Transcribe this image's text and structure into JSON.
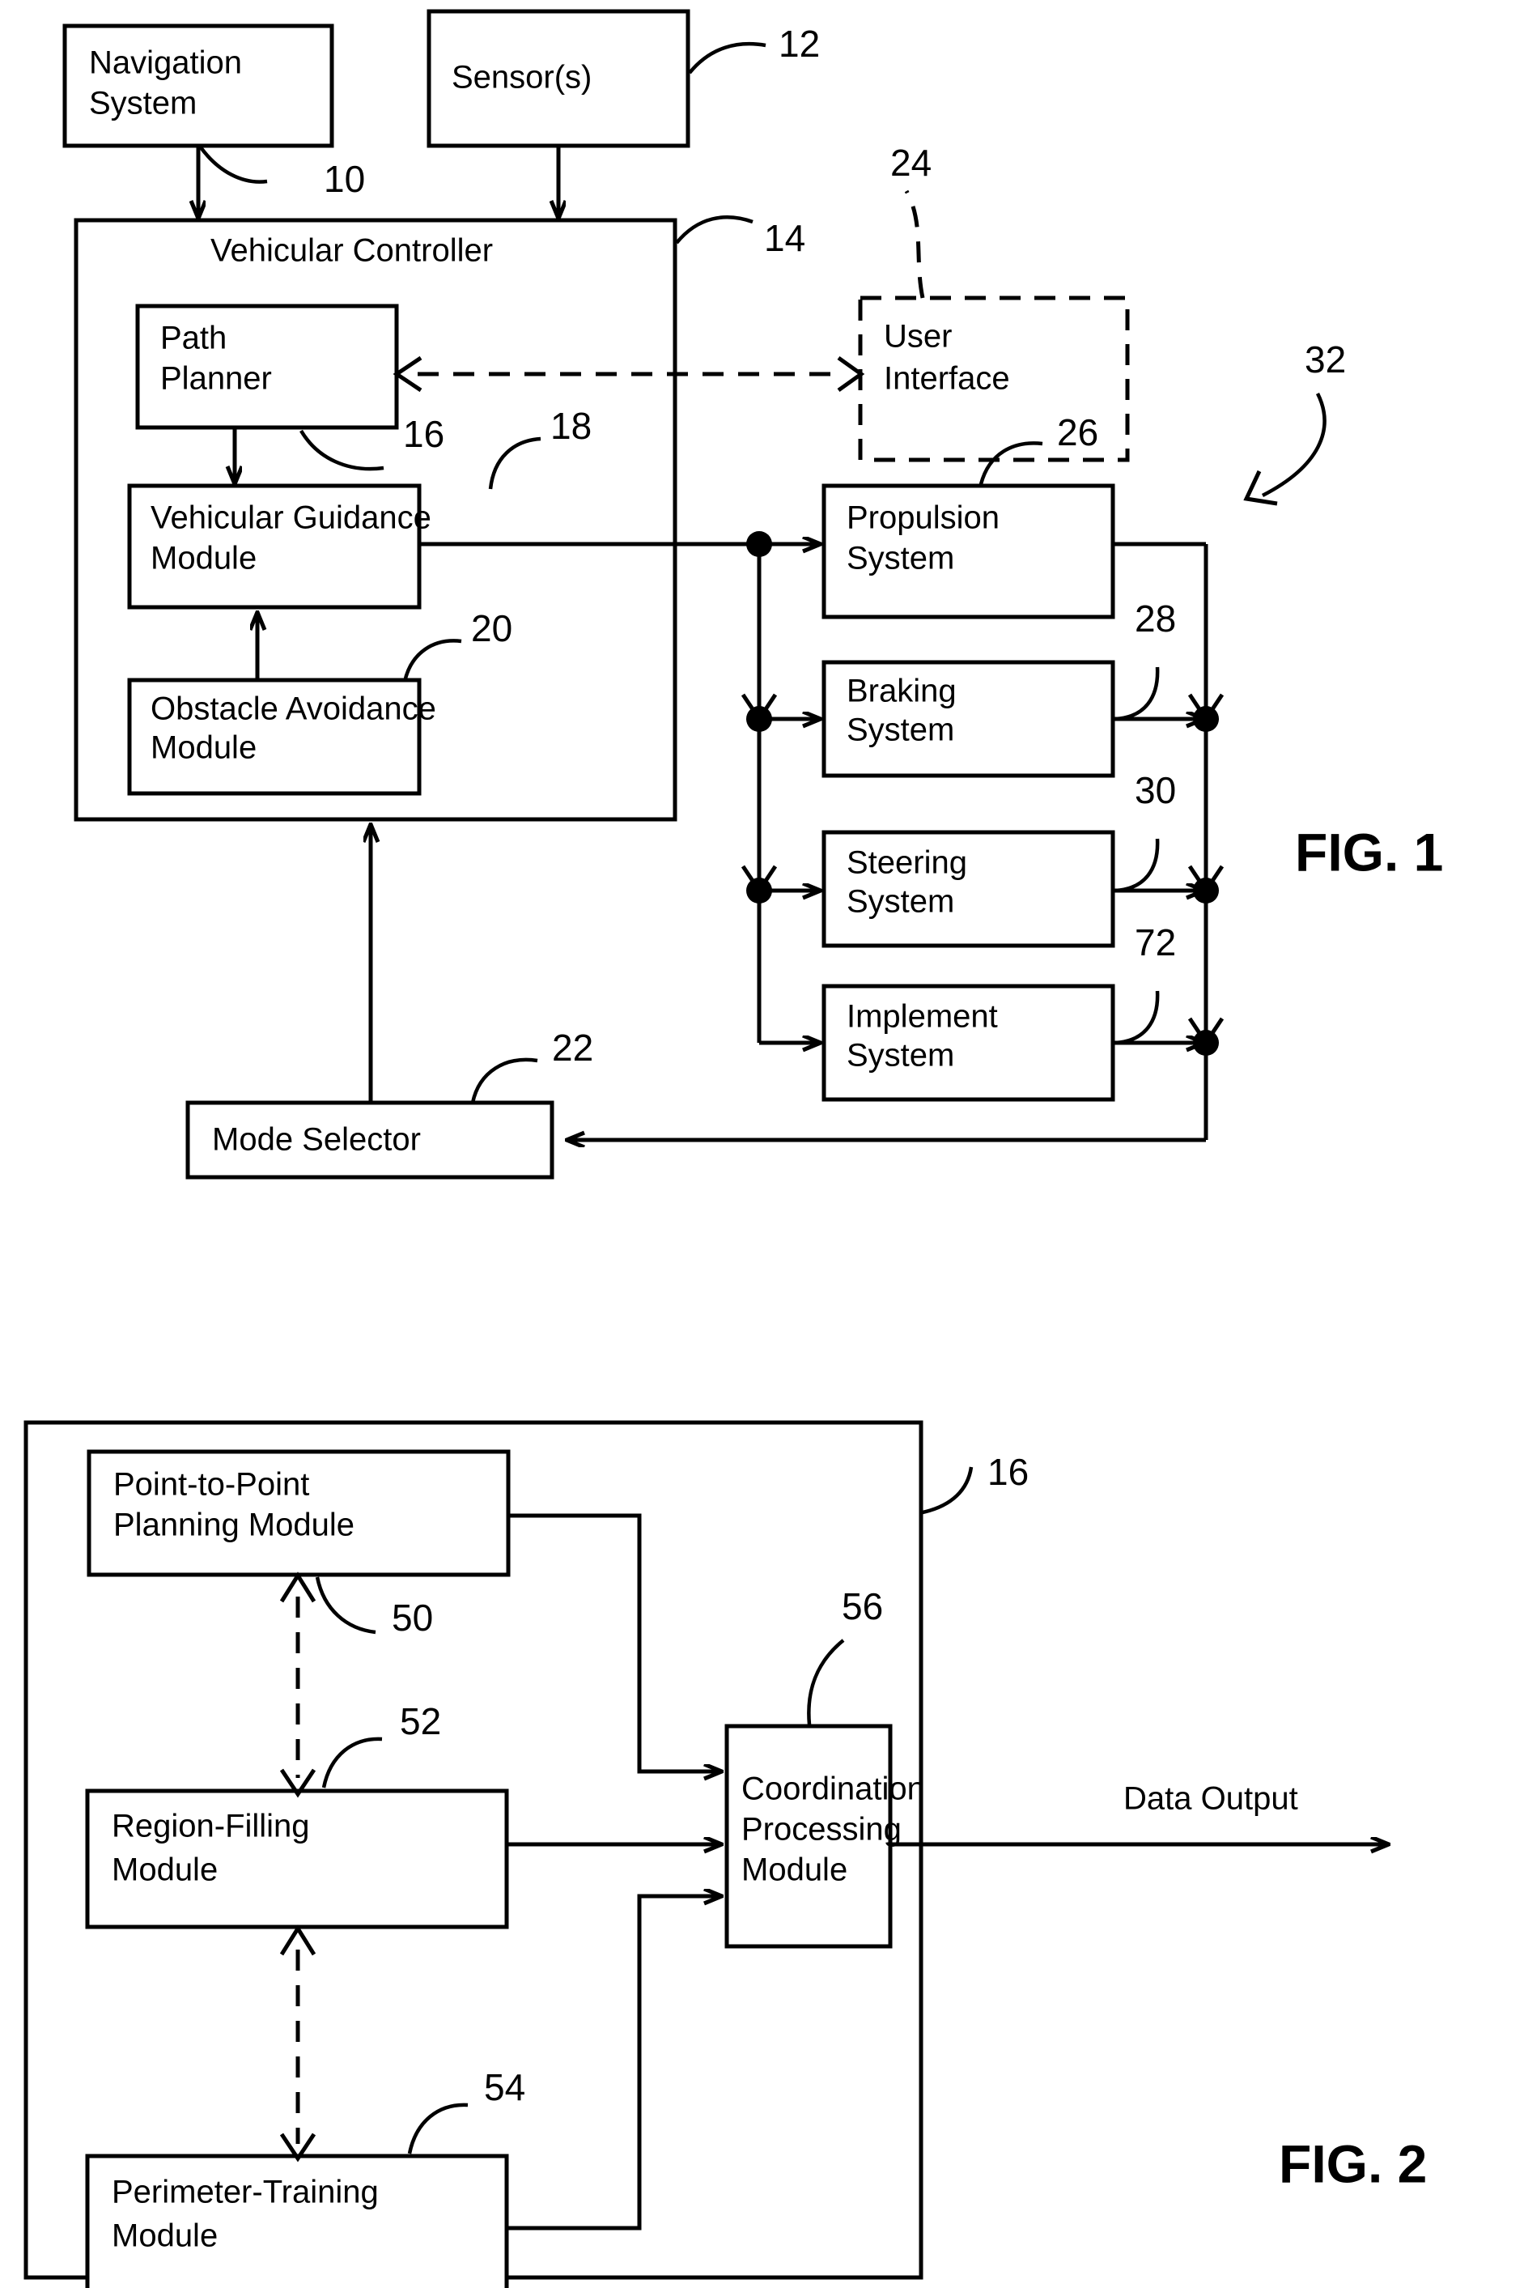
{
  "figures": [
    {
      "id": "fig1",
      "label": "FIG. 1",
      "boxes": {
        "navigation_system": "Navigation\nSystem",
        "navigation_system_l1": "Navigation",
        "navigation_system_l2": "System",
        "sensors": "Sensor(s)",
        "vehicular_controller": "Vehicular Controller",
        "path_planner_l1": "Path",
        "path_planner_l2": "Planner",
        "vehicular_guidance_l1": "Vehicular Guidance",
        "vehicular_guidance_l2": "Module",
        "obstacle_avoidance_l1": "Obstacle Avoidance",
        "obstacle_avoidance_l2": "Module",
        "mode_selector": "Mode Selector",
        "user_interface_l1": "User",
        "user_interface_l2": "Interface",
        "propulsion_l1": "Propulsion",
        "propulsion_l2": "System",
        "braking_l1": "Braking",
        "braking_l2": "System",
        "steering_l1": "Steering",
        "steering_l2": "System",
        "implement_l1": "Implement",
        "implement_l2": "System"
      },
      "reference_numerals": {
        "navigation_system": "10",
        "sensors": "12",
        "vehicular_controller": "14",
        "path_planner": "16",
        "vehicular_guidance": "18",
        "obstacle_avoidance": "20",
        "mode_selector": "22",
        "user_interface": "24",
        "propulsion": "26",
        "braking": "28",
        "steering": "30",
        "implement": "72",
        "system_overall": "32"
      }
    },
    {
      "id": "fig2",
      "label": "FIG. 2",
      "boxes": {
        "point_to_point_l1": "Point-to-Point",
        "point_to_point_l2": "Planning Module",
        "region_filling_l1": "Region-Filling",
        "region_filling_l2": "Module",
        "perimeter_training_l1": "Perimeter-Training",
        "perimeter_training_l2": "Module",
        "coordination_l1": "Coordination",
        "coordination_l2": "Processing",
        "coordination_l3": "Module"
      },
      "labels": {
        "data_output": "Data Output"
      },
      "reference_numerals": {
        "path_planner_container": "16",
        "point_to_point": "50",
        "region_filling": "52",
        "perimeter_training": "54",
        "coordination": "56"
      }
    }
  ],
  "colors": {
    "ink": "#000000",
    "paper": "#ffffff"
  }
}
